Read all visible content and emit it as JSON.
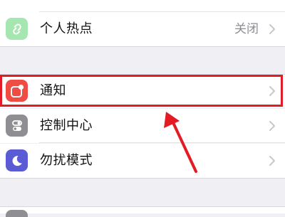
{
  "settings": {
    "rows": [
      {
        "label": "个人热点",
        "value": "关闭",
        "icon": "personal-hotspot-icon",
        "icon_color": "#a6e6b0"
      },
      {
        "label": "通知",
        "value": "",
        "icon": "notifications-icon",
        "icon_color": "#ef4c43"
      },
      {
        "label": "控制中心",
        "value": "",
        "icon": "control-center-icon",
        "icon_color": "#8e8e93"
      },
      {
        "label": "勿扰模式",
        "value": "",
        "icon": "do-not-disturb-icon",
        "icon_color": "#5b5bd6"
      }
    ]
  },
  "annotation": {
    "highlight_color": "#e21b25",
    "arrow_color": "#e21b25"
  }
}
